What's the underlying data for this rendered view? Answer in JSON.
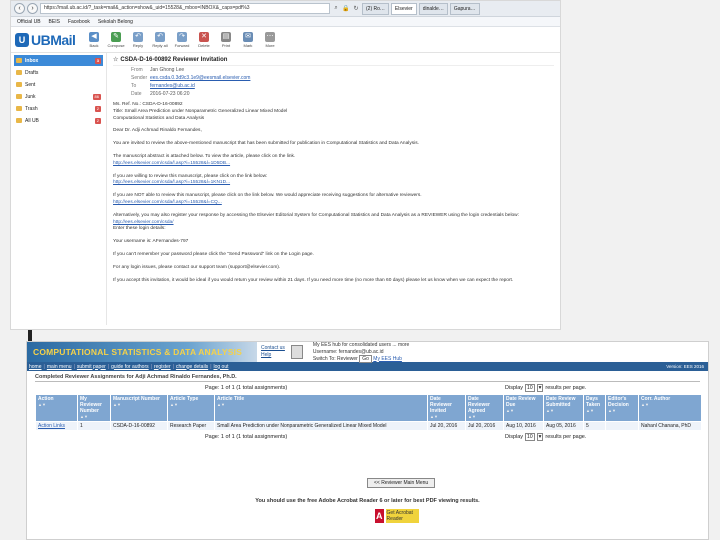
{
  "browser": {
    "address": "https://mail.ub.ac.id/?_task=mail&_action=show&_uid=15528&_mbox=INBOX&_caps=pdf%3",
    "tabs": [
      {
        "label": "(2) Ro…",
        "active": false
      },
      {
        "label": "Elsevier",
        "active": true
      },
      {
        "label": "dinalde…",
        "active": false
      },
      {
        "label": "Gapura…",
        "active": false
      }
    ],
    "bookmarks": [
      "Official UB",
      "BEIS",
      "Facebook",
      "Sekolah Belong"
    ]
  },
  "mail": {
    "logo": "UBMail",
    "toolbar": [
      "Back",
      "Compose",
      "Reply",
      "Reply all",
      "Forward",
      "Delete",
      "Print",
      "Mark",
      "More"
    ],
    "folders": [
      {
        "name": "Inbox",
        "badge": "3",
        "selected": true
      },
      {
        "name": "Drafts",
        "badge": "",
        "selected": false
      },
      {
        "name": "Sent",
        "badge": "",
        "selected": false
      },
      {
        "name": "Junk",
        "badge": "86",
        "selected": false
      },
      {
        "name": "Trash",
        "badge": "2",
        "selected": false
      },
      {
        "name": "All UB",
        "badge": "2",
        "selected": false
      }
    ],
    "subject": "CSDA-D-16-00892 Reviewer Invitation",
    "headers": [
      {
        "k": "From",
        "v": "Jan Ghong Lee"
      },
      {
        "k": "Sender",
        "v": "ees.csda.0.3d9c3.1e9@eesmail.elsevier.com"
      },
      {
        "k": "To",
        "v": "fernandes@ub.ac.id"
      },
      {
        "k": "Date",
        "v": "2016-07-23 06:20"
      }
    ],
    "body": [
      {
        "t": "Ms. Ref. No.: CSDA-D-16-00892"
      },
      {
        "t": "Title: Small Area Prediction under Nonparametric Generalized Linear Mixed Model"
      },
      {
        "t": "Computational Statistics and Data Analysis"
      },
      {
        "t": "Dear Dr. Adji Achmad Rinaldo Fernandes,"
      },
      {
        "t": "You are invited to review the above-mentioned manuscript that has been submitted for publication in Computational Statistics and Data Analysis."
      },
      {
        "t": "The manuscript abstract is attached below. To view the article, please click on the link.",
        "link": "http://ees.elsevier.com/csda/l.asp?i=15528&l=1D5DB..."
      },
      {
        "t": "If you are willing to review this manuscript, please click on the link below:",
        "link": "http://ees.elsevier.com/csda/l.asp?i=15528&l=1KN1D..."
      },
      {
        "t": "If you are NOT able to review this manuscript, please click on the link below. We would appreciate receiving suggestions for alternative reviewers.",
        "link": "http://ees.elsevier.com/csda/l.asp?i=15528&l=CQ..."
      },
      {
        "t": "Alternatively, you may also register your response by accessing the Elsevier Editorial System for Computational Statistics and Data Analysis as a REVIEWER using the login credentials below:",
        "link": "http://ees.elsevier.com/csda/"
      },
      {
        "t": "Enter these login details:"
      },
      {
        "t": "Your username is: AFernandes-797"
      },
      {
        "t": "If you can't remember your password please click the \"Send Password\" link on the Login page."
      },
      {
        "t": "For any login issues, please contact our support team (support@elsevier.com)."
      },
      {
        "t": "If you accept this invitation, it would be ideal if you would return your review within 21 days. If you need more time (no more than 60 days) please let us know when we can expect the report."
      }
    ]
  },
  "ees": {
    "title": "COMPUTATIONAL STATISTICS & DATA ANALYSIS",
    "util": [
      "Contact us",
      "Help"
    ],
    "user_line1": "My EES hub for consolidated users ... more",
    "user_line2": "Username: fernandes@ub.ac.id",
    "user_line3": "Switch To: Reviewer",
    "go": "Go",
    "myhub": "My EES Hub",
    "menu": [
      "home",
      "main menu",
      "submit paper",
      "guide for authors",
      "register",
      "change details",
      "log out"
    ],
    "version": "Version: EES 2016",
    "list_title": "Completed Reviewer Assignments for Adji Achmad Rinaldo Fernandes, Ph.D.",
    "pager": "Page: 1 of 1 (1 total assignments)",
    "display_label": "Display",
    "display_value": "10",
    "display_suffix": "results per page.",
    "columns": [
      "Action",
      "My Reviewer Number",
      "Manuscript Number",
      "Article Type",
      "Article Title",
      "Date Reviewer Invited",
      "Date Reviewer Agreed",
      "Date Review Due",
      "Date Review Submitted",
      "Days Taken",
      "Editor's Decision",
      "Corr. Author"
    ],
    "rows": [
      {
        "action": "Action Links",
        "reviewer_no": "1",
        "ms_no": "CSDA-D-16-00892",
        "type": "Research Paper",
        "title": "Small Area Prediction under Nonparametric Generalized Linear Mixed Model",
        "invited": "Jul 20, 2016",
        "agreed": "Jul 20, 2016",
        "due": "Aug 10, 2016",
        "submitted": "Aug 05, 2016",
        "days": "5",
        "decision": "",
        "author": "Nahanl Chanana, PhD"
      }
    ],
    "main_menu_btn": "<< Reviewer Main Menu",
    "adobe_note": "You should use the free Adobe Acrobat Reader 6 or later for best PDF viewing results.",
    "adobe_logo_text": "Get Acrobat Reader"
  }
}
